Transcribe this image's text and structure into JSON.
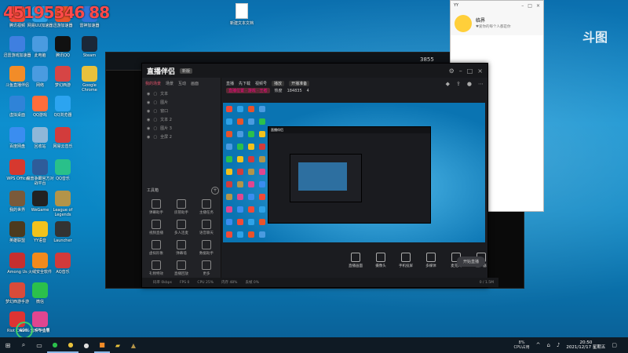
{
  "overlay_text": "45195346 88",
  "brand_logo": "斗图",
  "desktop_file": {
    "label": "新建文本文档"
  },
  "desktop_icons": [
    {
      "label": "腾讯视频",
      "color": "#f24a37"
    },
    {
      "label": "网易UU加速器",
      "color": "#2ea2e8"
    },
    {
      "label": "迅游加速器",
      "color": "#e8532b"
    },
    {
      "label": "雷神加速器",
      "color": "#2f74d9"
    },
    {
      "label": "迅雷游戏加速器",
      "color": "#3f7fe0"
    },
    {
      "label": "此电脑",
      "color": "#4a9be0"
    },
    {
      "label": "腾讯QQ",
      "color": "#111"
    },
    {
      "label": "Steam",
      "color": "#1b2838"
    },
    {
      "label": "斗鱼直播伴侣",
      "color": "#f28c28"
    },
    {
      "label": "网络",
      "color": "#4a9be0"
    },
    {
      "label": "梦幻西游",
      "color": "#d64545"
    },
    {
      "label": "Google Chrome",
      "color": "#e8c13c"
    },
    {
      "label": "虚拟桌面",
      "color": "#2f83d8"
    },
    {
      "label": "QQ游戏",
      "color": "#ff6d3a"
    },
    {
      "label": "QQ浏览器",
      "color": "#2ca4f0"
    },
    {
      "label": "百度网盘",
      "color": "#3a8df0"
    },
    {
      "label": "回收站",
      "color": "#8fb7d8"
    },
    {
      "label": "网易云音乐",
      "color": "#d23c3c"
    },
    {
      "label": "WPS Office",
      "color": "#d6392f"
    },
    {
      "label": "魔兽争霸官方对战平台",
      "color": "#2e5c9a"
    },
    {
      "label": "QQ音乐",
      "color": "#29c08a"
    },
    {
      "label": "我的世界",
      "color": "#7a5a3a"
    },
    {
      "label": "WeGame",
      "color": "#222"
    },
    {
      "label": "League of Legends",
      "color": "#b39449"
    },
    {
      "label": "英雄联盟",
      "color": "#4c3a1e"
    },
    {
      "label": "YY语音",
      "color": "#f2c21c"
    },
    {
      "label": "Launcher",
      "color": "#333"
    },
    {
      "label": "Among Us",
      "color": "#c62f2f"
    },
    {
      "label": "火绒安全软件",
      "color": "#f28a1c"
    },
    {
      "label": "AQ音乐",
      "color": "#d23a3a"
    },
    {
      "label": "梦幻西游手游",
      "color": "#d84b3a"
    },
    {
      "label": "微信",
      "color": "#2bc04b"
    },
    {
      "label": "Riot Client",
      "color": "#d33"
    },
    {
      "label": "剪映专业版",
      "color": "#e04690"
    }
  ],
  "game_window": {
    "stat": "3855"
  },
  "studio": {
    "logo": "直播伴侣",
    "badge": "新版",
    "tabs": [
      "我的场景",
      "场景",
      "互动",
      "画面"
    ],
    "layers": [
      "文本",
      "图片",
      "窗口",
      "文本 2",
      "图片 3",
      "全屏 2"
    ],
    "tools_title": "工具箱",
    "tools": [
      "弹幕助手",
      "房管助手",
      "主播任务",
      "视频直播",
      "多人连麦",
      "语音聊天",
      "虚拟形象",
      "弹幕墙",
      "数据助手",
      "礼物特效",
      "直播回放",
      "更多"
    ],
    "info": {
      "line1_a": "直播",
      "line1_b": "先下载",
      "line1_c": "视频号",
      "line1_tag": "播放",
      "line1_text": "开播准备",
      "line2_a": "直播位置 · 游戏 · 王者",
      "line2_b": "热度",
      "line2_c": "184835",
      "line2_d": "4"
    },
    "bottom_buttons": [
      "直播画面",
      "摄像头",
      "手机投屏",
      "多媒体",
      "麦克风",
      "扬声器"
    ],
    "go_live": "开始直播",
    "status": [
      "码率 0kbps",
      "FPS 0",
      "CPU 25%",
      "内存 48%",
      "丢帧 0%"
    ],
    "status_right": "0 / 1.5M"
  },
  "chat": {
    "top": "YY",
    "name": "临界",
    "sign": "♥爱你的每个人都是你",
    "foot": "2021年度直播盛典"
  },
  "cpu_widget": {
    "percent": "49%",
    "label": "CPU占用"
  },
  "taskbar": {
    "cpu_label": "8%",
    "cpu_sub": "CPU占用",
    "time": "20:50",
    "date": "2021/12/17 星期五"
  }
}
